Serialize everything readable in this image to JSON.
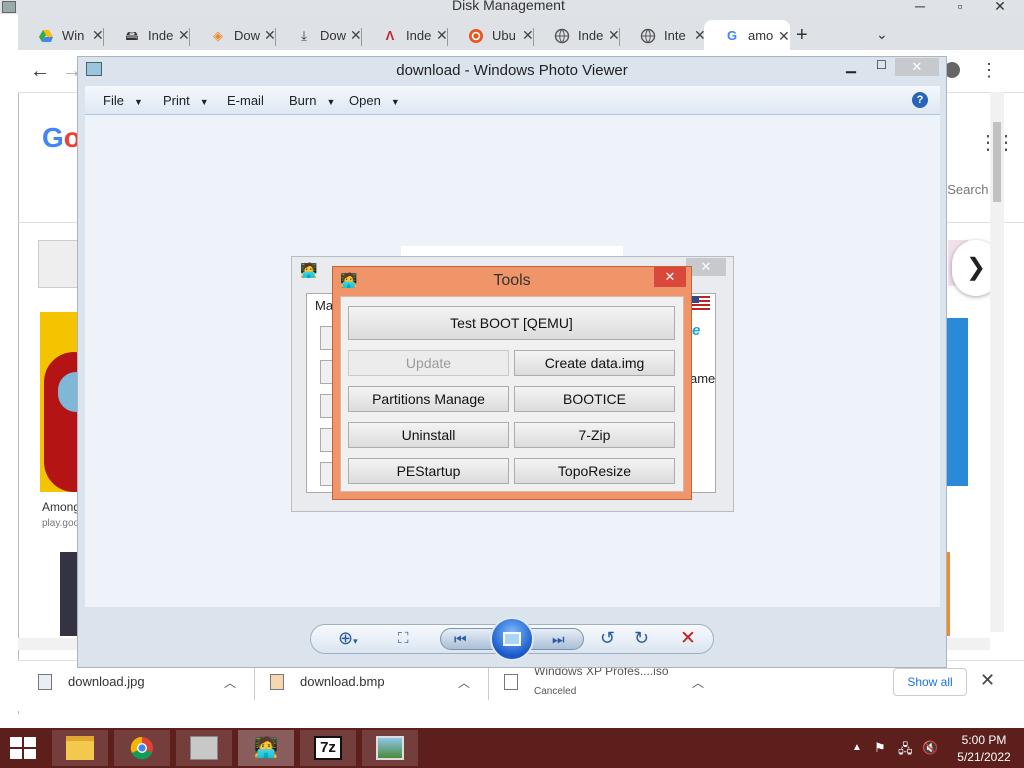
{
  "disk_management": {
    "title": "Disk Management"
  },
  "chrome": {
    "tabs": [
      {
        "label": "Win",
        "icon": "google-drive-icon"
      },
      {
        "label": "Inde",
        "icon": "disk-icon"
      },
      {
        "label": "Dow",
        "icon": "diamond-icon"
      },
      {
        "label": "Dow",
        "icon": "download-icon"
      },
      {
        "label": "Inde",
        "icon": "arch-icon"
      },
      {
        "label": "Ubu",
        "icon": "ubuntu-icon"
      },
      {
        "label": "Inde",
        "icon": "globe-icon"
      },
      {
        "label": "Inte",
        "icon": "globe-icon"
      },
      {
        "label": "amo",
        "icon": "google-icon"
      }
    ],
    "page": {
      "esearch": "eSearch",
      "among_title": "Among",
      "among_sub": "play.goo",
      "next_glyph": "❯"
    },
    "downloads": [
      {
        "name": "download.jpg"
      },
      {
        "name": "download.bmp"
      },
      {
        "name": "Windows XP Profes....iso",
        "status": "Canceled"
      }
    ],
    "show_all": "Show all"
  },
  "photo_viewer": {
    "title": "download - Windows Photo Viewer",
    "menu": [
      {
        "label": "File",
        "has_arrow": true
      },
      {
        "label": "Print",
        "has_arrow": true
      },
      {
        "label": "E-mail",
        "has_arrow": false
      },
      {
        "label": "Burn",
        "has_arrow": true
      },
      {
        "label": "Open",
        "has_arrow": true
      }
    ],
    "help_glyph": "?"
  },
  "background_app": {
    "ma": "Ma",
    "ame": "ame"
  },
  "tools_dialog": {
    "title": "Tools",
    "buttons": {
      "test_boot": "Test BOOT [QEMU]",
      "update": "Update",
      "create_data": "Create data.img",
      "partitions": "Partitions Manage",
      "bootice": "BOOTICE",
      "uninstall": "Uninstall",
      "sevenzip": "7-Zip",
      "pestartup": "PEStartup",
      "toporesize": "TopoResize"
    },
    "update_disabled": true,
    "accent_color": "#f0956a"
  },
  "taskbar": {
    "time": "5:00 PM",
    "date": "5/21/2022",
    "color": "#5c1f1c"
  }
}
